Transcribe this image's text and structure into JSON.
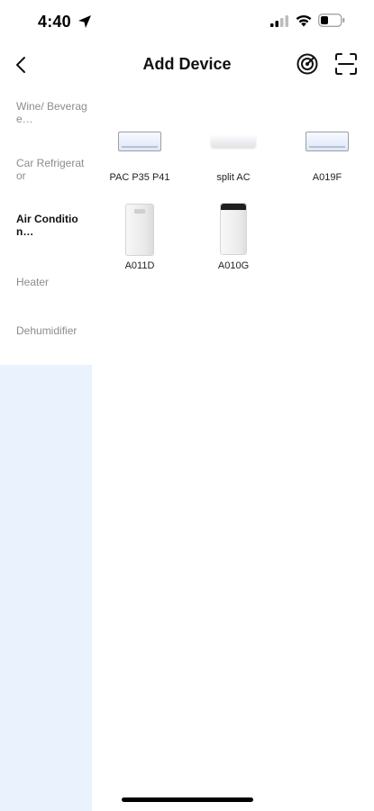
{
  "status_bar": {
    "time": "4:40",
    "icons": [
      "location-arrow-icon",
      "cellular-signal-icon",
      "wifi-icon",
      "battery-icon"
    ]
  },
  "nav": {
    "title": "Add Device",
    "back_icon": "chevron-left-icon",
    "right_icons": [
      "radar-scan-icon",
      "qr-scan-icon"
    ]
  },
  "categories": [
    {
      "label": "Wine/ Beverage…",
      "active": false
    },
    {
      "label": "Car Refrigerator",
      "active": false
    },
    {
      "label": "Air Condition…",
      "active": true
    },
    {
      "label": "Heater",
      "active": false
    },
    {
      "label": "Dehumidifier",
      "active": false
    }
  ],
  "devices": [
    {
      "label": "PAC P35 P41",
      "image": "window-ac-image"
    },
    {
      "label": "split AC",
      "image": "split-ac-image"
    },
    {
      "label": "A019F",
      "image": "window-ac-image"
    },
    {
      "label": "A011D",
      "image": "portable-ac-white-image"
    },
    {
      "label": "A010G",
      "image": "portable-ac-black-top-image"
    }
  ],
  "colors": {
    "sidebar_fill": "#eaf3fd",
    "active_text": "#111111",
    "inactive_text": "#8c8c8c"
  }
}
